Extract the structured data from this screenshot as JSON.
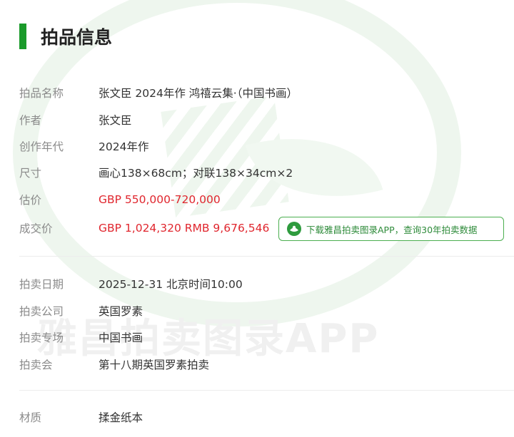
{
  "header": {
    "title": "拍品信息"
  },
  "watermark": {
    "text": "雅昌拍卖图录APP"
  },
  "lot": [
    {
      "label": "拍品名称",
      "value": "张文臣 2024年作 鸿禧云集·（中国书画）"
    },
    {
      "label": "作者",
      "value": "张文臣"
    },
    {
      "label": "创作年代",
      "value": "2024年作"
    },
    {
      "label": "尺寸",
      "value": "画心138×68cm；对联138×34cm×2"
    },
    {
      "label": "估价",
      "value": "GBP 550,000-720,000"
    },
    {
      "label": "成交价",
      "value": "GBP 1,024,320 RMB 9,676,546"
    }
  ],
  "app_promo": {
    "label": "下载雅昌拍卖图录APP，查询30年拍卖数据",
    "icon": "artron-logo-icon"
  },
  "auction": [
    {
      "label": "拍卖日期",
      "value": "2025-12-31 北京时间10:00"
    },
    {
      "label": "拍卖公司",
      "value": "英国罗素"
    },
    {
      "label": "拍卖专场",
      "value": "中国书画"
    },
    {
      "label": "拍卖会",
      "value": "第十八期英国罗素拍卖"
    }
  ],
  "material": [
    {
      "label": "材质",
      "value": "揉金纸本"
    }
  ],
  "colors": {
    "accent": "#1a9a2a",
    "price": "#e0262e",
    "label": "#8a8a8a",
    "button_border": "#4caf50"
  }
}
